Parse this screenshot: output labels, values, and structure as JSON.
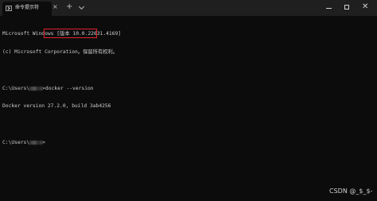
{
  "window": {
    "tab_title": "命令提示符",
    "tab_close_glyph": "×",
    "new_tab_glyph": "+",
    "close_glyph": "✕"
  },
  "console": {
    "lines": [
      "Microsoft Windows [版本 10.0.22631.4169]",
      "(c) Microsoft Corporation。保留所有权利。",
      "",
      "",
      "Docker version 27.2.0, build 3ab4256",
      "",
      ""
    ],
    "prompt_prefix": "C:\\Users\\",
    "prompt_suffix": ">",
    "command": "docker --version"
  },
  "watermark": "CSDN @_$_$-",
  "colors": {
    "background": "#0c0c0c",
    "text": "#cccccc",
    "titlebar": "#1f1f1f",
    "highlight": "#e0212b"
  }
}
